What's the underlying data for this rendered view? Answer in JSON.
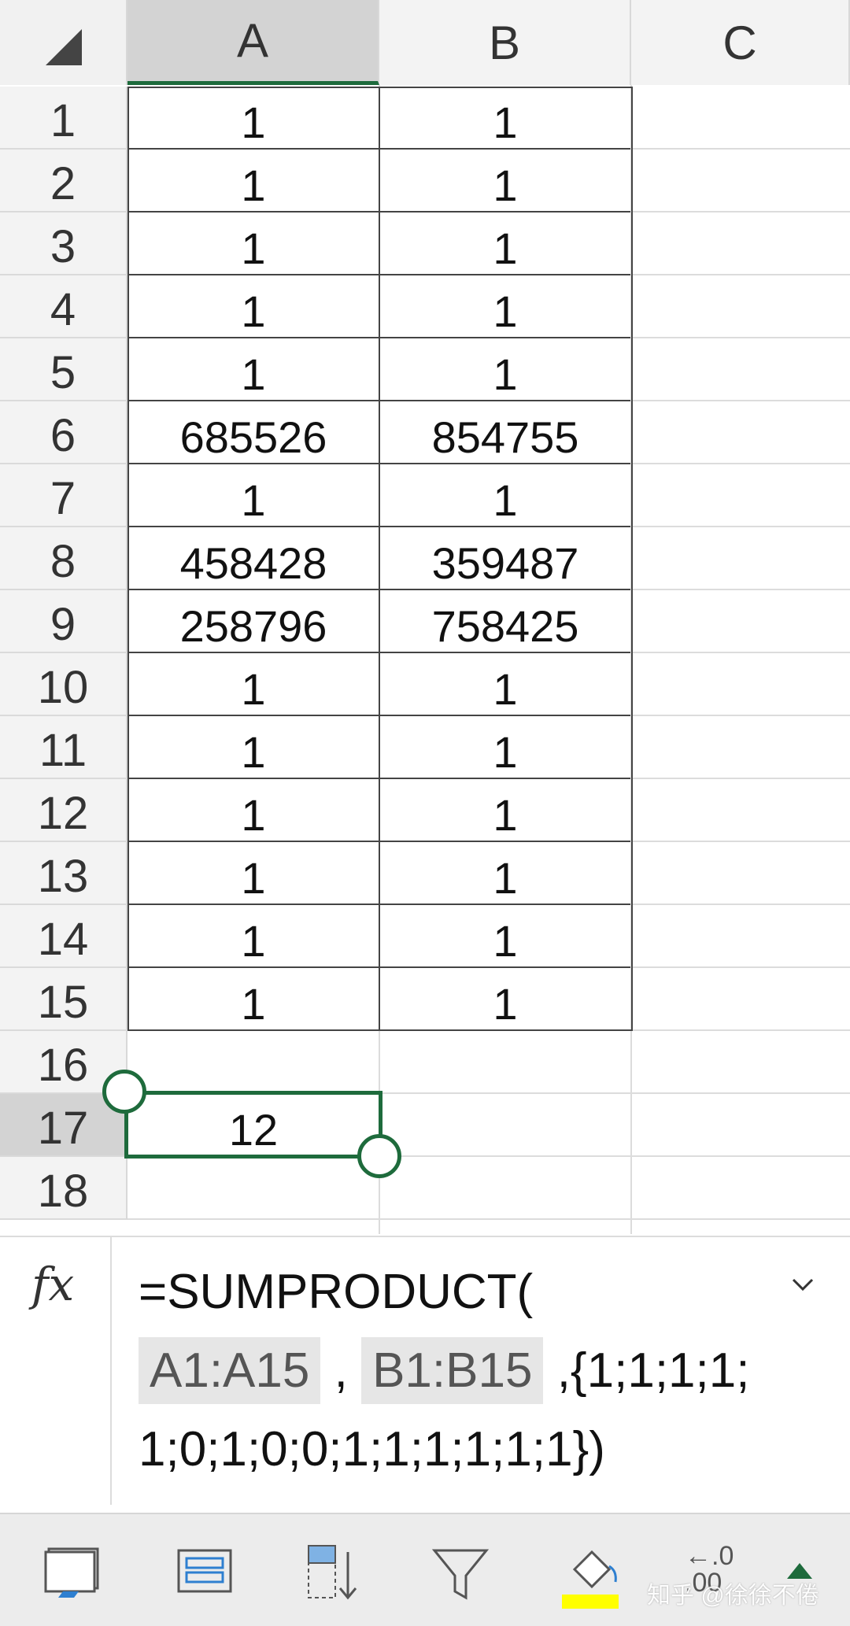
{
  "columns": [
    "A",
    "B",
    "C"
  ],
  "rows": [
    {
      "num": "1",
      "a": "1",
      "b": "1"
    },
    {
      "num": "2",
      "a": "1",
      "b": "1"
    },
    {
      "num": "3",
      "a": "1",
      "b": "1"
    },
    {
      "num": "4",
      "a": "1",
      "b": "1"
    },
    {
      "num": "5",
      "a": "1",
      "b": "1"
    },
    {
      "num": "6",
      "a": "685526",
      "b": "854755"
    },
    {
      "num": "7",
      "a": "1",
      "b": "1"
    },
    {
      "num": "8",
      "a": "458428",
      "b": "359487"
    },
    {
      "num": "9",
      "a": "258796",
      "b": "758425"
    },
    {
      "num": "10",
      "a": "1",
      "b": "1"
    },
    {
      "num": "11",
      "a": "1",
      "b": "1"
    },
    {
      "num": "12",
      "a": "1",
      "b": "1"
    },
    {
      "num": "13",
      "a": "1",
      "b": "1"
    },
    {
      "num": "14",
      "a": "1",
      "b": "1"
    },
    {
      "num": "15",
      "a": "1",
      "b": "1"
    },
    {
      "num": "16",
      "a": "",
      "b": ""
    },
    {
      "num": "17",
      "a": "12",
      "b": ""
    },
    {
      "num": "18",
      "a": "",
      "b": ""
    }
  ],
  "selected_cell": {
    "column": "A",
    "row": "17",
    "value": "12"
  },
  "formula_bar": {
    "fx_label": "fx",
    "prefix": "=SUMPRODUCT(",
    "ref1": "A1:A15",
    "sep1": " , ",
    "ref2": "B1:B15",
    "suffix_line1": " ,{1;1;1;1;",
    "line3": "1;0;1;0;0;1;1;1;1;1;1})",
    "expand_icon": "chevron-down-icon"
  },
  "toolbar": {
    "buttons": [
      "insert-cells-icon",
      "format-cells-icon",
      "sort-icon",
      "filter-icon",
      "fill-color-icon",
      "decimal-icon"
    ],
    "fill_color": "#ffff00",
    "decimal_label_top": "←.0",
    "decimal_label_bottom": ".00",
    "watermark": "知乎 @徐徐不倦"
  },
  "colors": {
    "accent": "#1e6b3c",
    "header_bg": "#f3f3f3",
    "selected_header_bg": "#d3d3d3"
  }
}
